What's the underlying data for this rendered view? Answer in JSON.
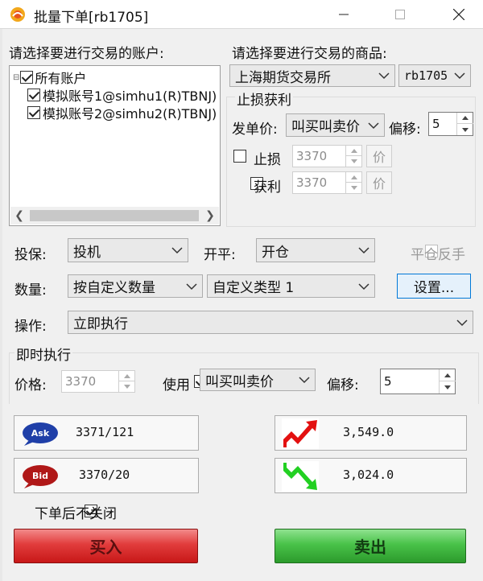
{
  "window": {
    "title": "批量下单[rb1705]"
  },
  "accounts": {
    "label": "请选择要进行交易的账户:",
    "root": "所有账户",
    "items": [
      "模拟账号1@simhu1(R)TBNJ)",
      "模拟账号2@simhu2(R)TBNJ)"
    ]
  },
  "product": {
    "label": "请选择要进行交易的商品:",
    "exchange": "上海期货交易所",
    "contract": "rb1705"
  },
  "stoploss": {
    "group_title": "止损获利",
    "order_price_label": "发单价:",
    "order_price_value": "叫买叫卖价",
    "offset_label": "偏移:",
    "offset_value": "5",
    "stop_label": "止损",
    "stop_value": "3370",
    "profit_label": "获利",
    "profit_value": "3370",
    "price_btn": "价"
  },
  "order": {
    "hedge_label": "投保:",
    "hedge_value": "投机",
    "openclose_label": "开平:",
    "openclose_value": "开仓",
    "reverse_label": "平仓反手",
    "qty_label": "数量:",
    "qty_mode": "按自定义数量",
    "qty_type": "自定义类型 1",
    "settings_btn": "设置...",
    "action_label": "操作:",
    "action_value": "立即执行"
  },
  "immediate": {
    "group_title": "即时执行",
    "price_label": "价格:",
    "price_value": "3370",
    "use_label": "使用",
    "use_value": "叫买叫卖价",
    "offset_label": "偏移:",
    "offset_value": "5"
  },
  "quotes": {
    "ask_badge": "Ask",
    "ask_value": "3371/121",
    "bid_badge": "Bid",
    "bid_value": "3370/20",
    "high_value": "3,549.0",
    "low_value": "3,024.0"
  },
  "footer": {
    "keep_open_label": "下单后不关闭",
    "buy_label": "买入",
    "sell_label": "卖出"
  },
  "colors": {
    "buy": "#d92b2b",
    "sell": "#3cb43c",
    "ask_badge": "#1f3fa8",
    "bid_badge": "#b01818"
  }
}
